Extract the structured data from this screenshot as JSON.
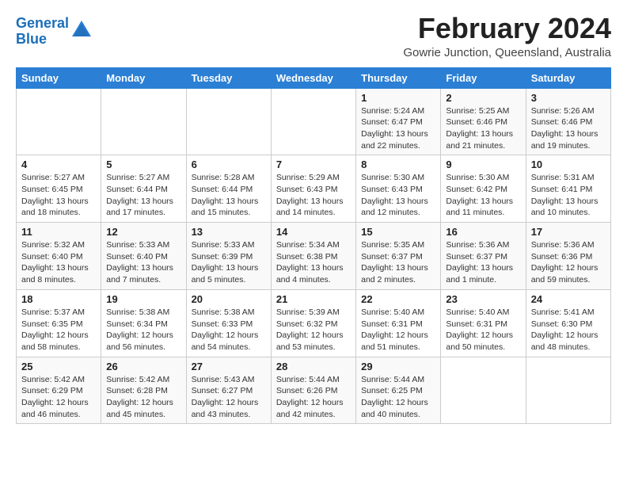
{
  "header": {
    "logo_line1": "General",
    "logo_line2": "Blue",
    "month_year": "February 2024",
    "location": "Gowrie Junction, Queensland, Australia"
  },
  "days_of_week": [
    "Sunday",
    "Monday",
    "Tuesday",
    "Wednesday",
    "Thursday",
    "Friday",
    "Saturday"
  ],
  "weeks": [
    [
      {
        "day": "",
        "detail": ""
      },
      {
        "day": "",
        "detail": ""
      },
      {
        "day": "",
        "detail": ""
      },
      {
        "day": "",
        "detail": ""
      },
      {
        "day": "1",
        "detail": "Sunrise: 5:24 AM\nSunset: 6:47 PM\nDaylight: 13 hours\nand 22 minutes."
      },
      {
        "day": "2",
        "detail": "Sunrise: 5:25 AM\nSunset: 6:46 PM\nDaylight: 13 hours\nand 21 minutes."
      },
      {
        "day": "3",
        "detail": "Sunrise: 5:26 AM\nSunset: 6:46 PM\nDaylight: 13 hours\nand 19 minutes."
      }
    ],
    [
      {
        "day": "4",
        "detail": "Sunrise: 5:27 AM\nSunset: 6:45 PM\nDaylight: 13 hours\nand 18 minutes."
      },
      {
        "day": "5",
        "detail": "Sunrise: 5:27 AM\nSunset: 6:44 PM\nDaylight: 13 hours\nand 17 minutes."
      },
      {
        "day": "6",
        "detail": "Sunrise: 5:28 AM\nSunset: 6:44 PM\nDaylight: 13 hours\nand 15 minutes."
      },
      {
        "day": "7",
        "detail": "Sunrise: 5:29 AM\nSunset: 6:43 PM\nDaylight: 13 hours\nand 14 minutes."
      },
      {
        "day": "8",
        "detail": "Sunrise: 5:30 AM\nSunset: 6:43 PM\nDaylight: 13 hours\nand 12 minutes."
      },
      {
        "day": "9",
        "detail": "Sunrise: 5:30 AM\nSunset: 6:42 PM\nDaylight: 13 hours\nand 11 minutes."
      },
      {
        "day": "10",
        "detail": "Sunrise: 5:31 AM\nSunset: 6:41 PM\nDaylight: 13 hours\nand 10 minutes."
      }
    ],
    [
      {
        "day": "11",
        "detail": "Sunrise: 5:32 AM\nSunset: 6:40 PM\nDaylight: 13 hours\nand 8 minutes."
      },
      {
        "day": "12",
        "detail": "Sunrise: 5:33 AM\nSunset: 6:40 PM\nDaylight: 13 hours\nand 7 minutes."
      },
      {
        "day": "13",
        "detail": "Sunrise: 5:33 AM\nSunset: 6:39 PM\nDaylight: 13 hours\nand 5 minutes."
      },
      {
        "day": "14",
        "detail": "Sunrise: 5:34 AM\nSunset: 6:38 PM\nDaylight: 13 hours\nand 4 minutes."
      },
      {
        "day": "15",
        "detail": "Sunrise: 5:35 AM\nSunset: 6:37 PM\nDaylight: 13 hours\nand 2 minutes."
      },
      {
        "day": "16",
        "detail": "Sunrise: 5:36 AM\nSunset: 6:37 PM\nDaylight: 13 hours\nand 1 minute."
      },
      {
        "day": "17",
        "detail": "Sunrise: 5:36 AM\nSunset: 6:36 PM\nDaylight: 12 hours\nand 59 minutes."
      }
    ],
    [
      {
        "day": "18",
        "detail": "Sunrise: 5:37 AM\nSunset: 6:35 PM\nDaylight: 12 hours\nand 58 minutes."
      },
      {
        "day": "19",
        "detail": "Sunrise: 5:38 AM\nSunset: 6:34 PM\nDaylight: 12 hours\nand 56 minutes."
      },
      {
        "day": "20",
        "detail": "Sunrise: 5:38 AM\nSunset: 6:33 PM\nDaylight: 12 hours\nand 54 minutes."
      },
      {
        "day": "21",
        "detail": "Sunrise: 5:39 AM\nSunset: 6:32 PM\nDaylight: 12 hours\nand 53 minutes."
      },
      {
        "day": "22",
        "detail": "Sunrise: 5:40 AM\nSunset: 6:31 PM\nDaylight: 12 hours\nand 51 minutes."
      },
      {
        "day": "23",
        "detail": "Sunrise: 5:40 AM\nSunset: 6:31 PM\nDaylight: 12 hours\nand 50 minutes."
      },
      {
        "day": "24",
        "detail": "Sunrise: 5:41 AM\nSunset: 6:30 PM\nDaylight: 12 hours\nand 48 minutes."
      }
    ],
    [
      {
        "day": "25",
        "detail": "Sunrise: 5:42 AM\nSunset: 6:29 PM\nDaylight: 12 hours\nand 46 minutes."
      },
      {
        "day": "26",
        "detail": "Sunrise: 5:42 AM\nSunset: 6:28 PM\nDaylight: 12 hours\nand 45 minutes."
      },
      {
        "day": "27",
        "detail": "Sunrise: 5:43 AM\nSunset: 6:27 PM\nDaylight: 12 hours\nand 43 minutes."
      },
      {
        "day": "28",
        "detail": "Sunrise: 5:44 AM\nSunset: 6:26 PM\nDaylight: 12 hours\nand 42 minutes."
      },
      {
        "day": "29",
        "detail": "Sunrise: 5:44 AM\nSunset: 6:25 PM\nDaylight: 12 hours\nand 40 minutes."
      },
      {
        "day": "",
        "detail": ""
      },
      {
        "day": "",
        "detail": ""
      }
    ]
  ]
}
